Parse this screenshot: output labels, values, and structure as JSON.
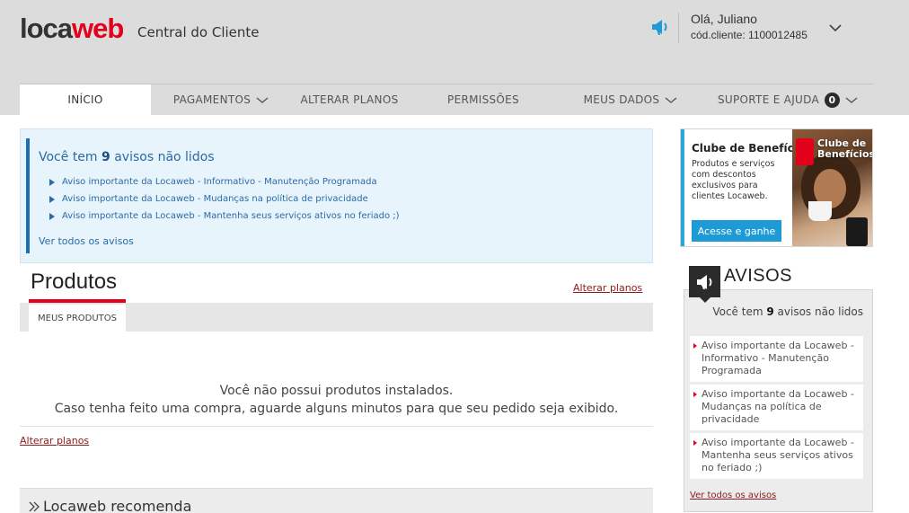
{
  "header": {
    "logo_main": "loca",
    "logo_accent": "web",
    "subtitle": "Central do Cliente",
    "user_greeting": "Olá, Juliano",
    "user_code": "cód.cliente:  1100012485",
    "colors": {
      "header_bg": "#dcdcdc",
      "brand_red": "#e2001a",
      "icon_blue": "#1e9bd7"
    }
  },
  "nav": {
    "items": [
      {
        "label": "INÍCIO"
      },
      {
        "label": "PAGAMENTOS"
      },
      {
        "label": "ALTERAR PLANOS"
      },
      {
        "label": "PERMISSÕES"
      },
      {
        "label": "MEUS DADOS"
      },
      {
        "label": "SUPORTE E AJUDA"
      }
    ],
    "support_badge": "0"
  },
  "notices": {
    "title_prefix": "Você tem",
    "count": "9",
    "title_suffix": "avisos não lidos",
    "items": [
      "Aviso importante da Locaweb - Informativo - Manutenção Programada",
      "Aviso importante da Locaweb - Mudanças na política de privacidade",
      "Aviso importante da Locaweb - Mantenha seus serviços ativos no feriado ;)"
    ],
    "see_all": "Ver todos os avisos"
  },
  "products": {
    "title": "Produtos",
    "alter_link": "Alterar planos",
    "tab_label": "MEUS PRODUTOS",
    "empty_line1": "Você não possui produtos instalados.",
    "empty_line2": "Caso tenha feito uma compra, aguarde alguns minutos para que seu pedido seja exibido.",
    "alter_link_bottom": "Alterar planos"
  },
  "recommend": {
    "title": "Locaweb recomenda"
  },
  "banner": {
    "title": "Clube de Benefícios",
    "description": "Produtos e serviços com descontos exclusivos para clientes Locaweb.",
    "button": "Acesse e ganhe",
    "tag_label": "Clube de Benefícios"
  },
  "avisos": {
    "title": "AVISOS",
    "count_prefix": "Você tem",
    "count": "9",
    "count_suffix": "avisos não lidos",
    "items": [
      "Aviso importante da Locaweb - Informativo - Manutenção Programada",
      "Aviso importante da Locaweb - Mudanças na política de privacidade",
      "Aviso importante da Locaweb - Mantenha seus serviços ativos no feriado ;)"
    ],
    "see_all": "Ver todos os avisos"
  }
}
